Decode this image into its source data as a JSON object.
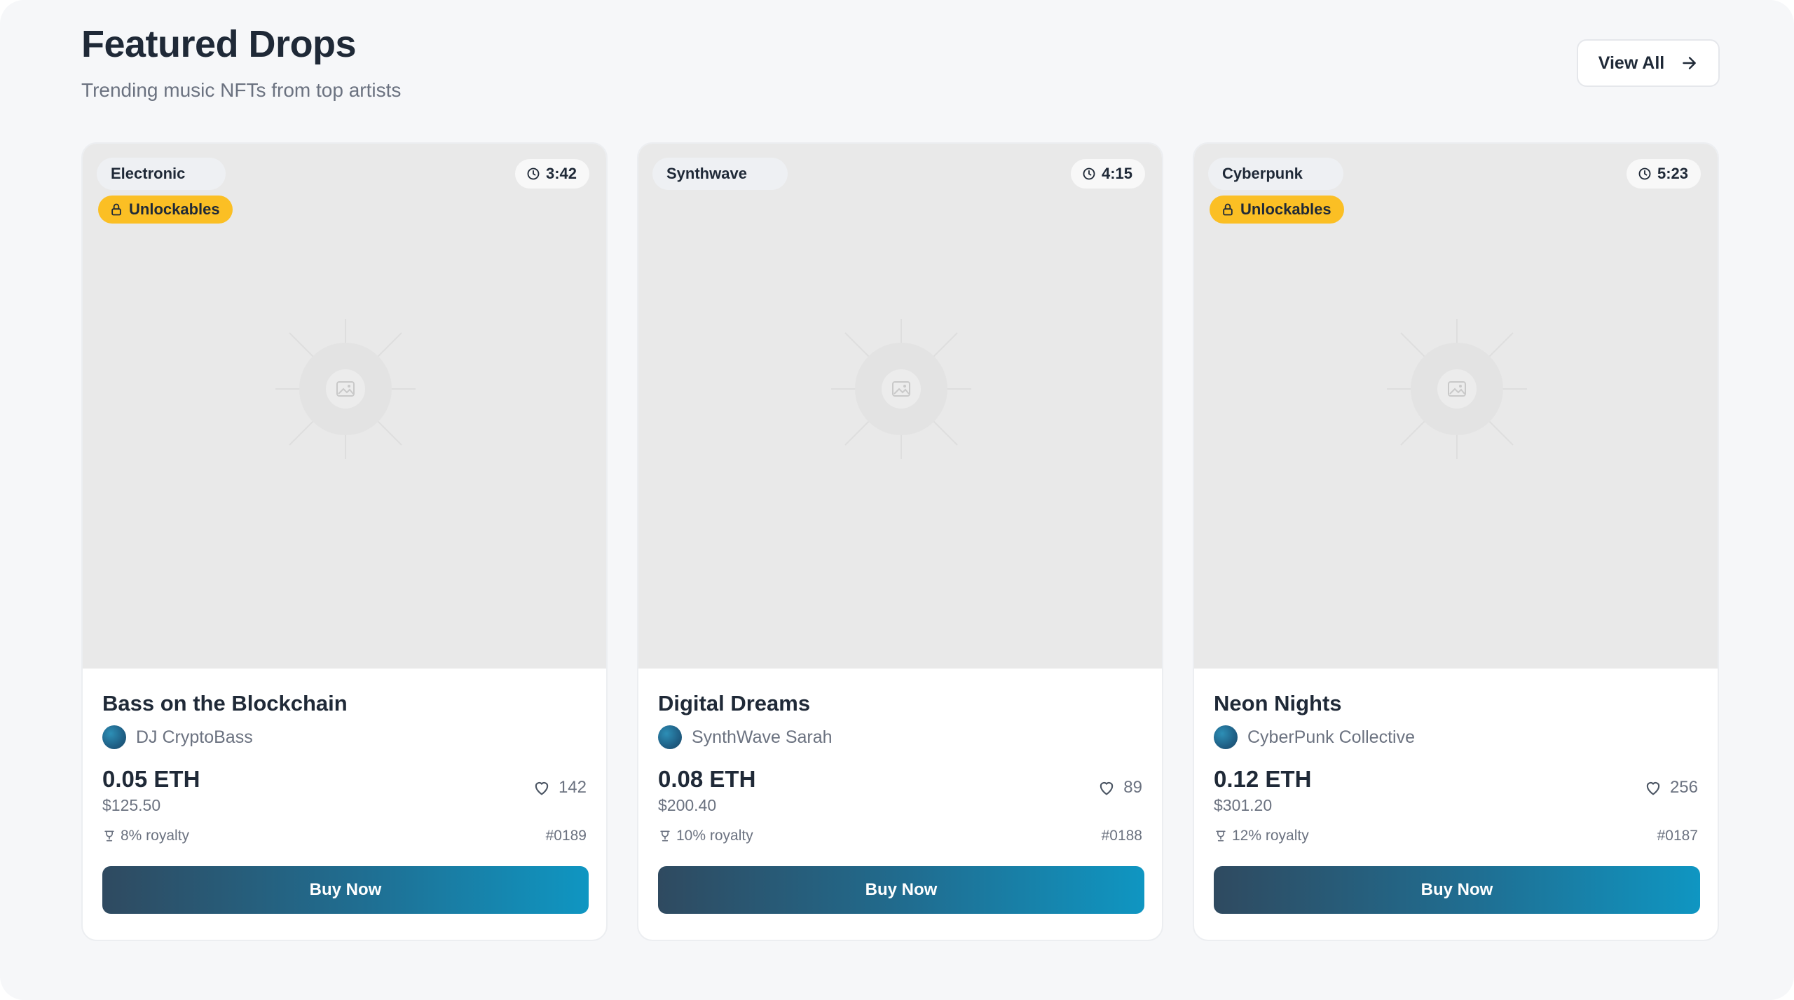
{
  "header": {
    "title": "Featured Drops",
    "subtitle": "Trending music NFTs from top artists",
    "view_all_label": "View All"
  },
  "cards": [
    {
      "genre": "Electronic",
      "duration": "3:42",
      "unlockables_label": "Unlockables",
      "has_unlockables": true,
      "title": "Bass on the Blockchain",
      "artist": "DJ CryptoBass",
      "price_eth": "0.05 ETH",
      "price_usd": "$125.50",
      "likes": "142",
      "royalty": "8% royalty",
      "token_id": "#0189",
      "buy_label": "Buy Now"
    },
    {
      "genre": "Synthwave",
      "duration": "4:15",
      "unlockables_label": "",
      "has_unlockables": false,
      "title": "Digital Dreams",
      "artist": "SynthWave Sarah",
      "price_eth": "0.08 ETH",
      "price_usd": "$200.40",
      "likes": "89",
      "royalty": "10% royalty",
      "token_id": "#0188",
      "buy_label": "Buy Now"
    },
    {
      "genre": "Cyberpunk",
      "duration": "5:23",
      "unlockables_label": "Unlockables",
      "has_unlockables": true,
      "title": "Neon Nights",
      "artist": "CyberPunk Collective",
      "price_eth": "0.12 ETH",
      "price_usd": "$301.20",
      "likes": "256",
      "royalty": "12% royalty",
      "token_id": "#0187",
      "buy_label": "Buy Now"
    }
  ],
  "colors": {
    "background": "#f6f7f9",
    "card": "#ffffff",
    "art_placeholder": "#e9e9e9",
    "unlockables_badge": "#fbbf24",
    "button_gradient_start": "#2f4a60",
    "button_gradient_end": "#0f96c2"
  },
  "icons": {
    "view_all": "arrow-right-icon",
    "duration": "clock-icon",
    "unlockables": "lock-icon",
    "art": "image-placeholder-icon",
    "likes": "heart-icon",
    "royalty": "trophy-icon"
  }
}
